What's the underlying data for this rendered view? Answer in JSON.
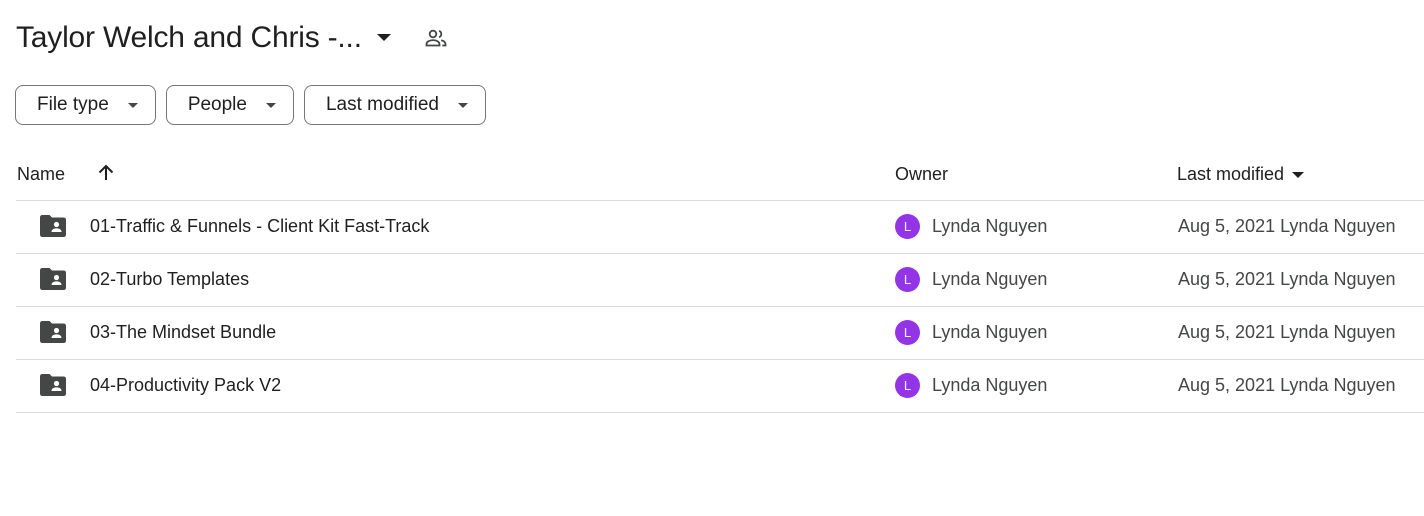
{
  "header": {
    "title": "Taylor Welch and Chris -...",
    "title_caret_icon": "caret-down-icon",
    "shared_icon": "people-icon"
  },
  "filters": [
    {
      "label": "File type",
      "icon": "caret-down-icon"
    },
    {
      "label": "People",
      "icon": "caret-down-icon"
    },
    {
      "label": "Last modified",
      "icon": "caret-down-icon"
    }
  ],
  "table": {
    "columns": {
      "name": "Name",
      "owner": "Owner",
      "last_modified": "Last modified"
    },
    "sort_icon": "arrow-up-icon",
    "rows": [
      {
        "name": "01-Traffic & Funnels - Client Kit Fast-Track",
        "icon": "shared-folder-icon",
        "owner_initial": "L",
        "owner": "Lynda Nguyen",
        "modified": "Aug 5, 2021 Lynda Nguyen"
      },
      {
        "name": "02-Turbo Templates",
        "icon": "shared-folder-icon",
        "owner_initial": "L",
        "owner": "Lynda Nguyen",
        "modified": "Aug 5, 2021 Lynda Nguyen"
      },
      {
        "name": "03-The Mindset Bundle",
        "icon": "shared-folder-icon",
        "owner_initial": "L",
        "owner": "Lynda Nguyen",
        "modified": "Aug 5, 2021 Lynda Nguyen"
      },
      {
        "name": "04-Productivity Pack V2",
        "icon": "shared-folder-icon",
        "owner_initial": "L",
        "owner": "Lynda Nguyen",
        "modified": "Aug 5, 2021 Lynda Nguyen"
      }
    ]
  },
  "colors": {
    "avatar": "#9334e6",
    "icon": "#444746",
    "divider": "#dadce0",
    "chip_border": "#747775"
  }
}
